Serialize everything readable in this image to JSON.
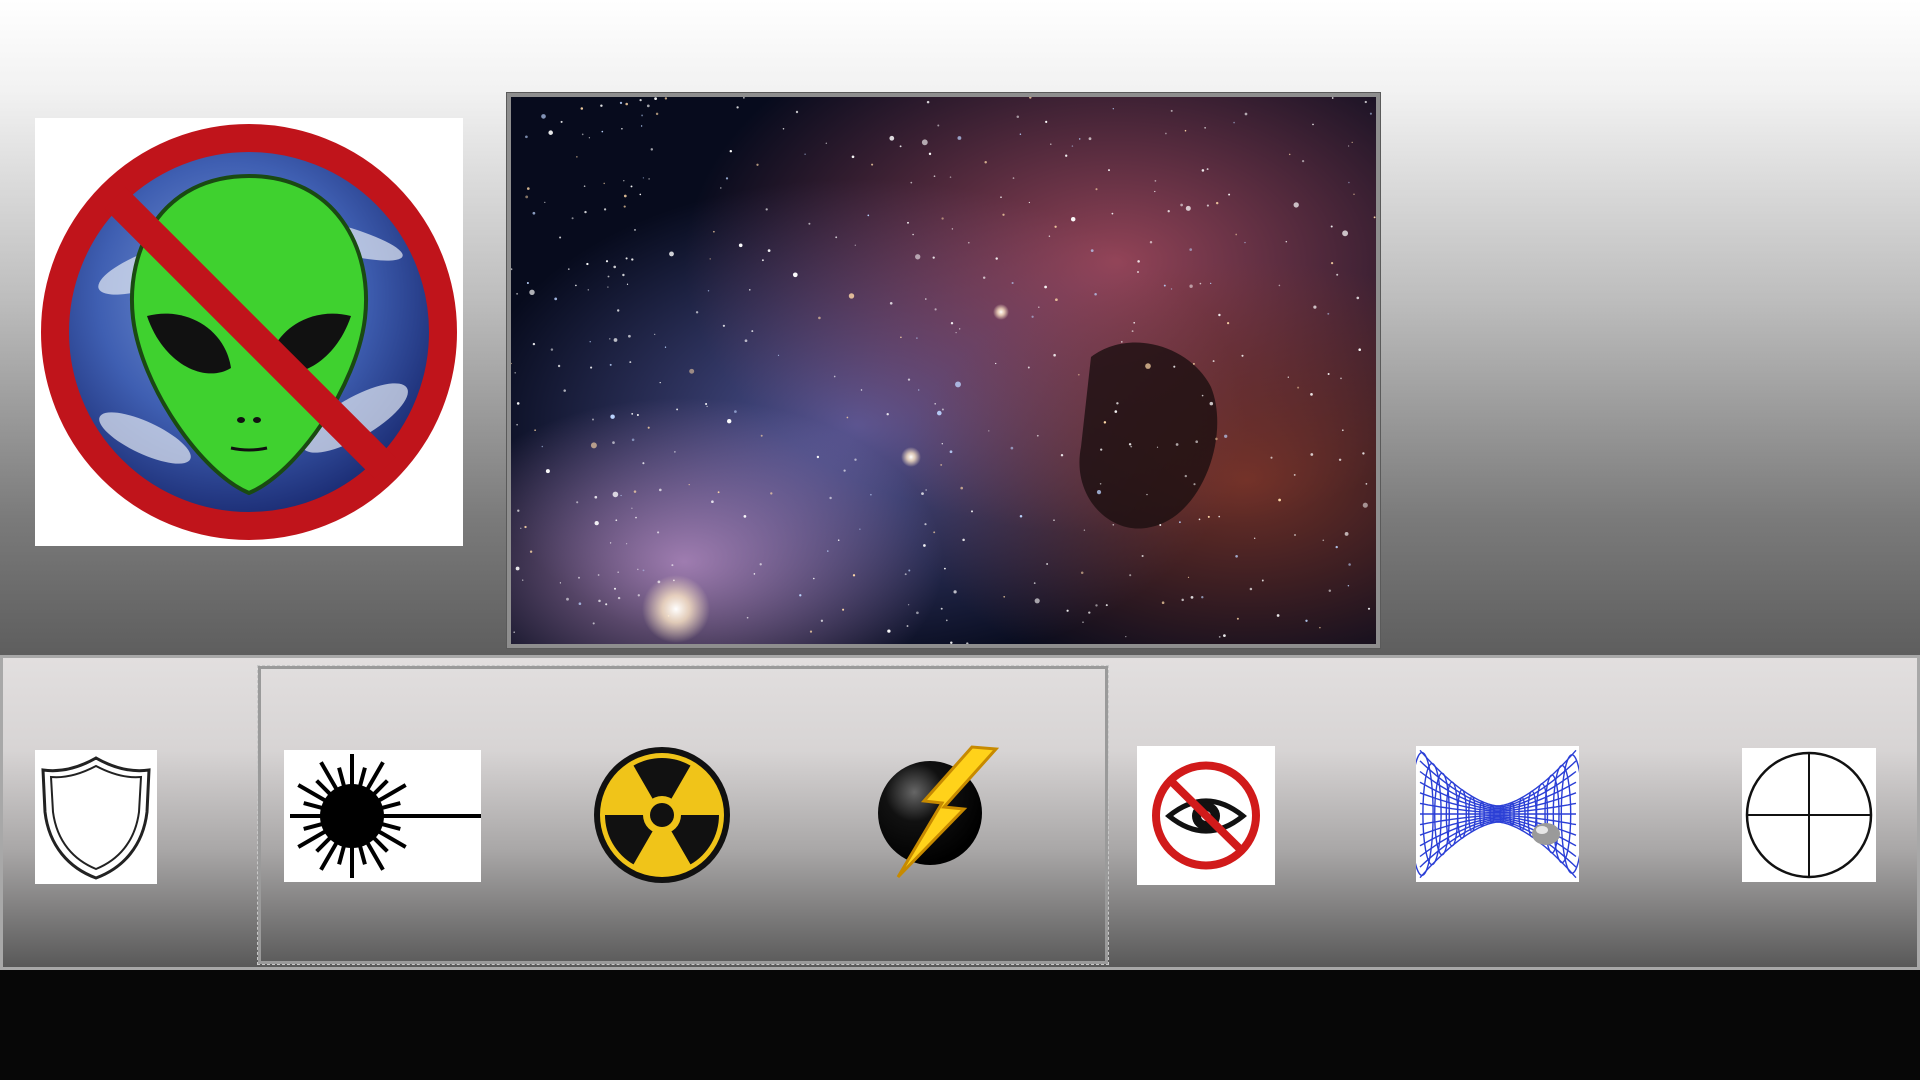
{
  "scene": {
    "description_icons": [
      "no-alien-icon",
      "space-nebula-image",
      "shield-icon",
      "laser-icon",
      "radiation-icon",
      "lightning-icon",
      "no-eye-icon",
      "wormhole-icon",
      "crosshair-icon"
    ]
  },
  "colors": {
    "prohibition_red": "#c0141b",
    "alien_green": "#39d12c",
    "radiation_yellow": "#f0c419",
    "bolt_yellow": "#ffd21a",
    "wormhole_blue": "#2b3fd6",
    "footer": "#070707"
  }
}
